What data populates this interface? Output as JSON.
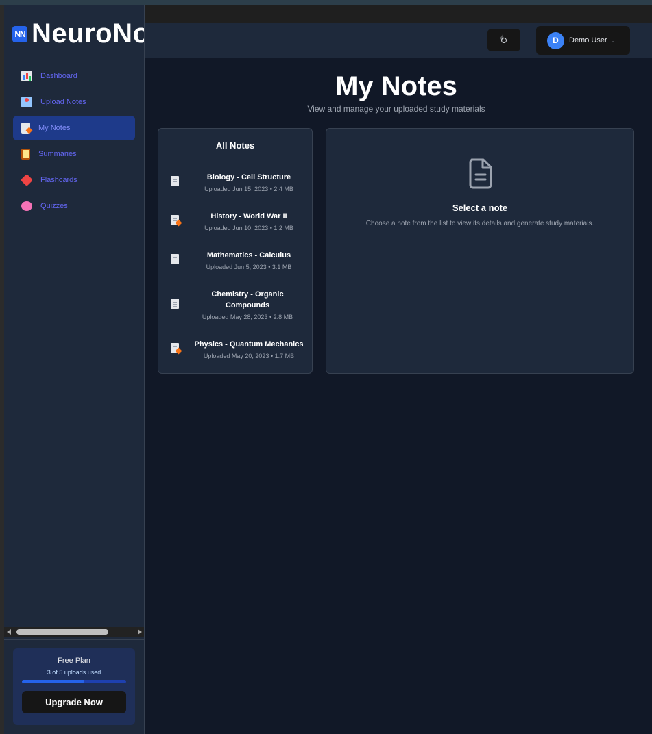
{
  "brand": {
    "logo": "NN",
    "name": "NeuroNotes"
  },
  "sidebar": {
    "items": [
      {
        "label": "Dashboard",
        "icon": "chart-icon",
        "active": false
      },
      {
        "label": "Upload Notes",
        "icon": "upload-icon",
        "active": false
      },
      {
        "label": "My Notes",
        "icon": "document-icon",
        "active": true
      },
      {
        "label": "Summaries",
        "icon": "clipboard-icon",
        "active": false
      },
      {
        "label": "Flashcards",
        "icon": "tag-icon",
        "active": false
      },
      {
        "label": "Quizzes",
        "icon": "brain-icon",
        "active": false
      }
    ],
    "plan": {
      "title": "Free Plan",
      "usage": "3 of 5 uploads used",
      "progress_fraction": 0.6,
      "button": "Upgrade Now"
    }
  },
  "header": {
    "theme_icon": "sun-icon",
    "avatar_initial": "D",
    "user_name": "Demo User"
  },
  "main": {
    "title": "My Notes",
    "subtitle": "View and manage your uploaded study materials",
    "list_title": "All Notes",
    "notes": [
      {
        "title": "Biology - Cell Structure",
        "meta": "Uploaded Jun 15, 2023 • 2.4 MB",
        "icon": "document-icon"
      },
      {
        "title": "History - World War II",
        "meta": "Uploaded Jun 10, 2023 • 1.2 MB",
        "icon": "memo-icon"
      },
      {
        "title": "Mathematics - Calculus",
        "meta": "Uploaded Jun 5, 2023 • 3.1 MB",
        "icon": "document-icon"
      },
      {
        "title": "Chemistry - Organic Compounds",
        "meta": "Uploaded May 28, 2023 • 2.8 MB",
        "icon": "document-icon"
      },
      {
        "title": "Physics - Quantum Mechanics",
        "meta": "Uploaded May 20, 2023 • 1.7 MB",
        "icon": "memo-icon"
      }
    ],
    "detail": {
      "icon": "file-text-icon",
      "title": "Select a note",
      "text": "Choose a note from the list to view its details and generate study materials."
    }
  },
  "colors": {
    "accent": "#2563eb",
    "nav_text": "#6366f1",
    "background": "#111827",
    "panel": "#1e293b"
  }
}
